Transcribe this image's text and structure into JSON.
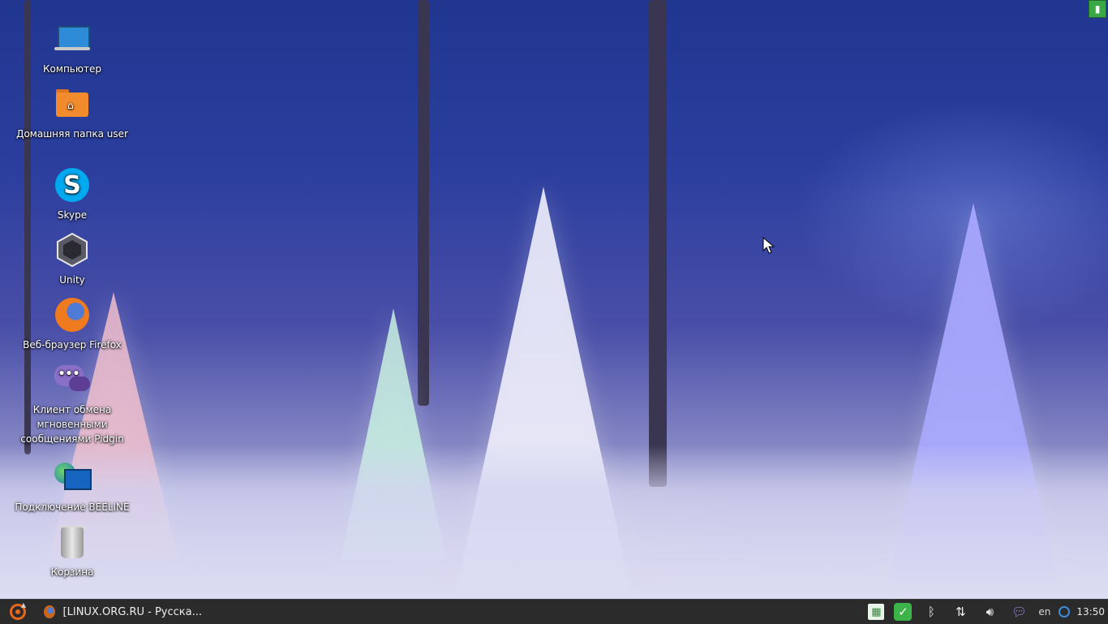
{
  "desktop": {
    "icons": [
      {
        "label": "Компьютер",
        "icon": "computer-icon"
      },
      {
        "label": "Домашняя папка user",
        "icon": "home-folder-icon"
      },
      {
        "label": "Skype",
        "icon": "skype-icon"
      },
      {
        "label": "Unity",
        "icon": "unity-icon"
      },
      {
        "label": "Веб-браузер Firefox",
        "icon": "firefox-icon"
      },
      {
        "label": "Клиент обмена мгновенными сообщениями Pidgin",
        "icon": "pidgin-icon"
      },
      {
        "label": "Подключение BEELINE",
        "icon": "network-connection-icon"
      },
      {
        "label": "Корзина",
        "icon": "trash-icon"
      }
    ]
  },
  "taskbar": {
    "start_icon": "ubuntu-menu-icon",
    "window_title": "[LINUX.ORG.RU - Русска...",
    "tray": {
      "icons": [
        "apps-grid-icon",
        "check-icon",
        "bluetooth-icon",
        "network-arrows-icon",
        "volume-icon",
        "chat-icon"
      ],
      "language": "en",
      "time": "13:50"
    }
  },
  "colors": {
    "taskbar_bg": "#2b2b2b",
    "accent": "#e8661c"
  }
}
